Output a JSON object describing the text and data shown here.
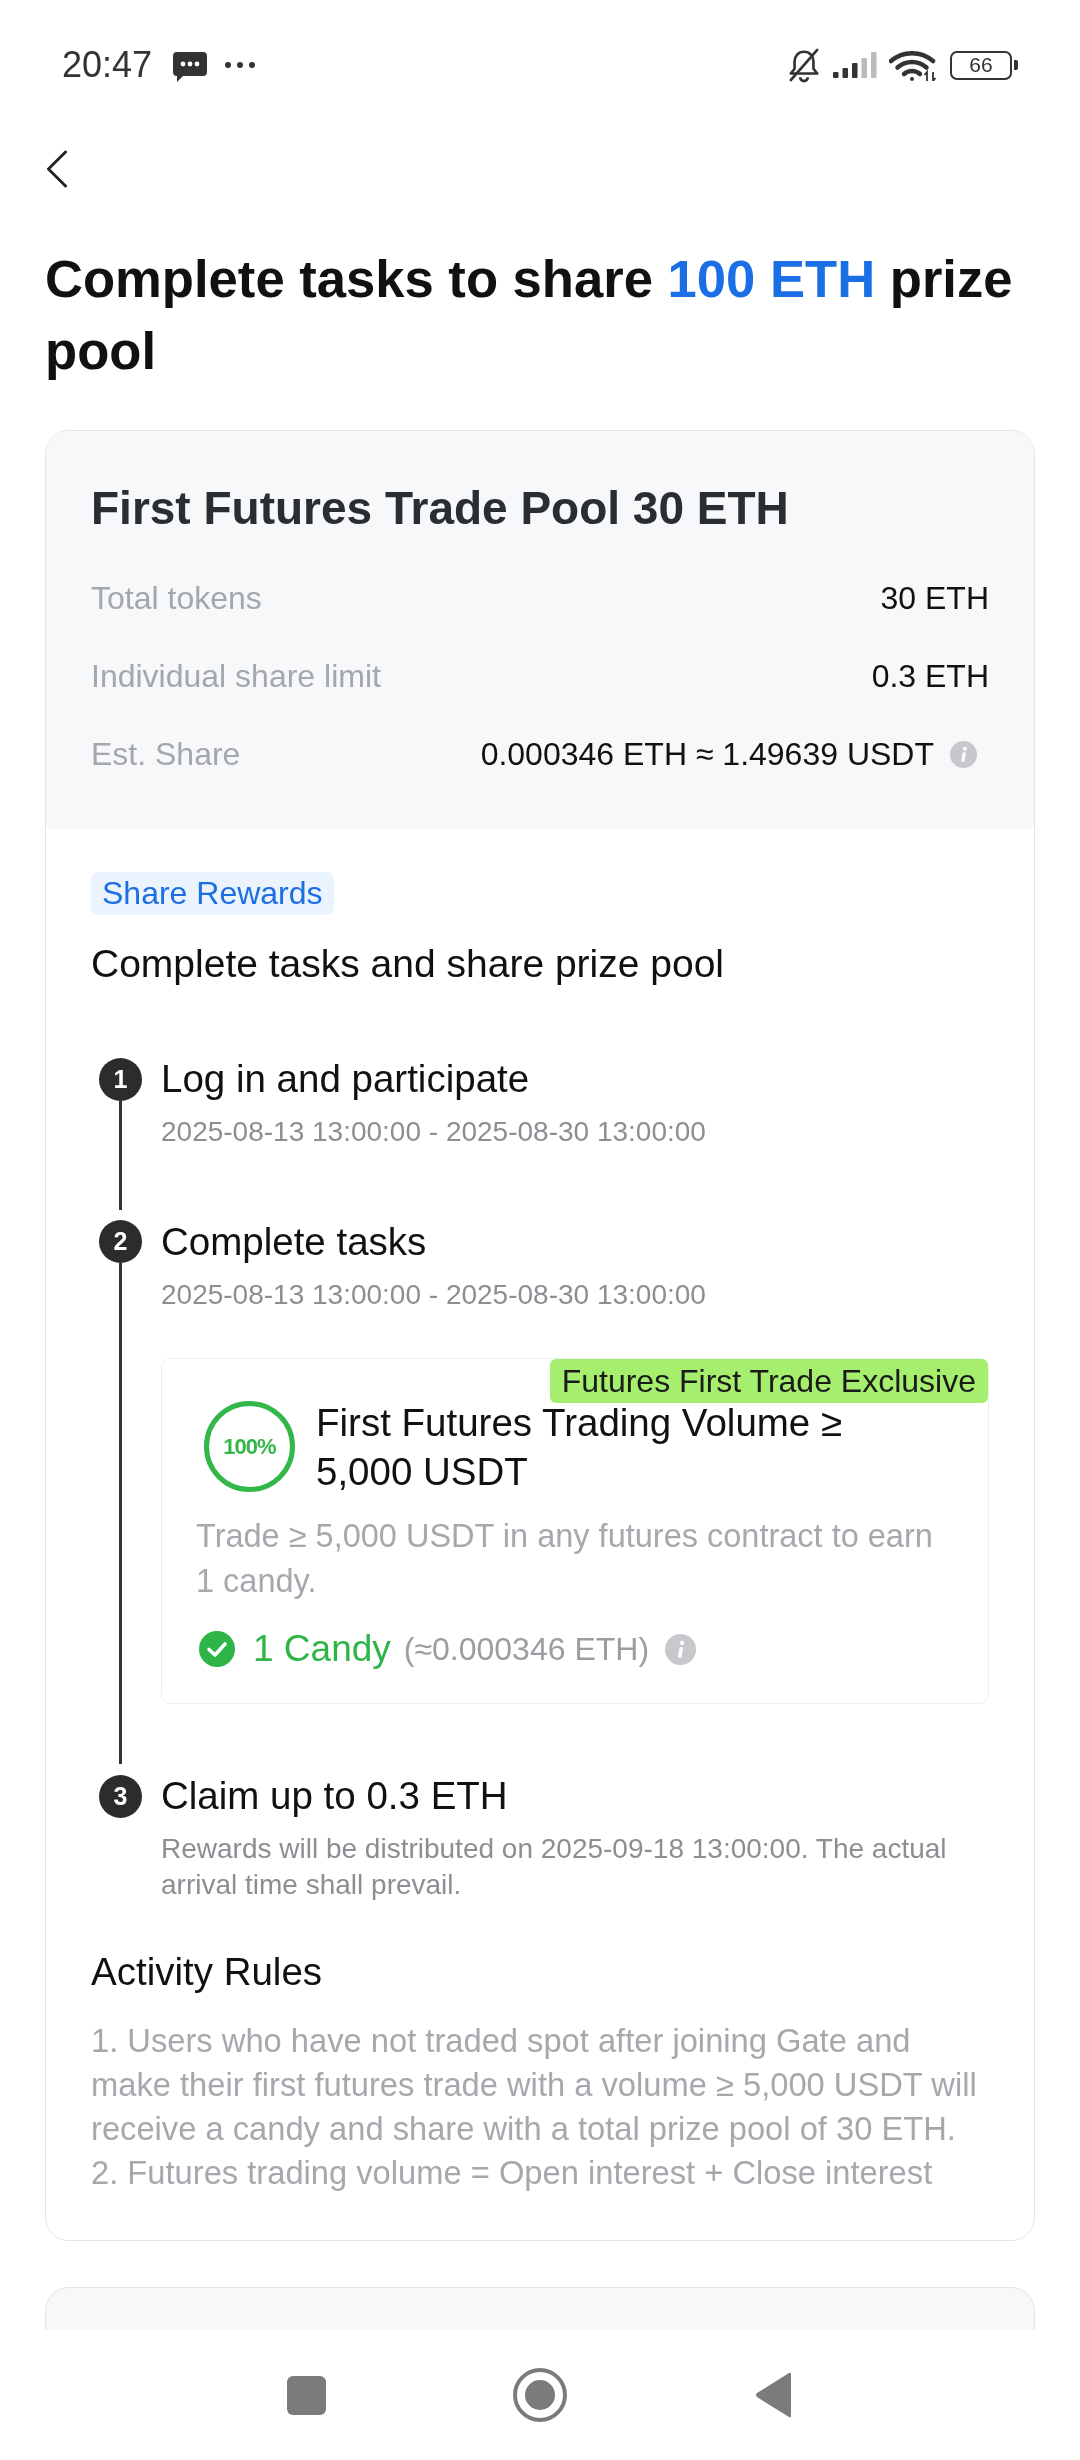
{
  "status_bar": {
    "time": "20:47",
    "battery": "66"
  },
  "header": {
    "title": [
      {
        "text": "Complete tasks to share ",
        "highlight": false
      },
      {
        "text": "100 ETH",
        "highlight": true
      },
      {
        "text": " prize pool",
        "highlight": false
      }
    ]
  },
  "pool_card": {
    "title": "First Futures Trade Pool 30 ETH",
    "rows": [
      {
        "label": "Total tokens",
        "value": "30 ETH",
        "info": false
      },
      {
        "label": "Individual share limit",
        "value": "0.3 ETH",
        "info": false
      },
      {
        "label": "Est. Share",
        "value": "0.000346 ETH ≈ 1.49639 USDT",
        "info": true
      }
    ],
    "tag": "Share Rewards",
    "subtitle": "Complete tasks and share prize pool",
    "steps": [
      {
        "number": "1",
        "title": "Log in and participate",
        "detail": "2025-08-13 13:00:00 - 2025-08-30 13:00:00"
      },
      {
        "number": "2",
        "title": "Complete tasks",
        "detail": "2025-08-13 13:00:00 - 2025-08-30 13:00:00",
        "tasks": [
          {
            "badge": "Futures First Trade Exclusive",
            "progress": "100%",
            "level": 1,
            "title": "First Futures Trading Volume ≥ 5,000 USDT",
            "description": "Trade ≥ 5,000 USDT in any futures contract to earn 1 candy.",
            "completed": true,
            "reward": "1 Candy",
            "reward_note": "(≈0.000346 ETH)",
            "info": true
          }
        ]
      },
      {
        "number": "3",
        "title": "Claim up to 0.3 ETH",
        "detail": "Rewards will be distributed on 2025-09-18 13:00:00. The actual arrival time shall prevail."
      }
    ],
    "rules": {
      "title": "Activity Rules",
      "items": [
        "1. Users who have not traded spot after joining Gate and make their first futures trade with a volume ≥ 5,000 USDT will receive a candy and share with a total prize pool of 30 ETH.",
        "2. Futures trading volume = Open interest + Close interest"
      ]
    }
  }
}
